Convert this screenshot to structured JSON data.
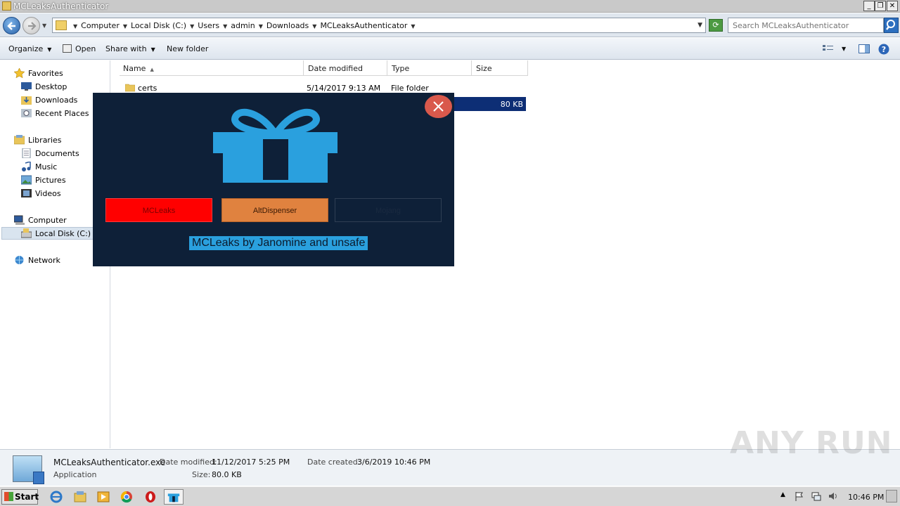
{
  "window": {
    "title": "MCLeaksAuthenticator",
    "controls": [
      "_",
      "❐",
      "✕"
    ]
  },
  "address_bar": {
    "breadcrumbs": [
      "Computer",
      "Local Disk (C:)",
      "Users",
      "admin",
      "Downloads",
      "MCLeaksAuthenticator"
    ],
    "search_placeholder": "Search MCLeaksAuthenticator"
  },
  "toolbar": {
    "organize": "Organize",
    "open": "Open",
    "share_with": "Share with",
    "new_folder": "New folder"
  },
  "nav": {
    "favorites": "Favorites",
    "desktop": "Desktop",
    "downloads": "Downloads",
    "recent_places": "Recent Places",
    "libraries": "Libraries",
    "documents": "Documents",
    "music": "Music",
    "pictures": "Pictures",
    "videos": "Videos",
    "computer": "Computer",
    "local_disk": "Local Disk (C:)",
    "network": "Network"
  },
  "columns": {
    "name": "Name",
    "date_modified": "Date modified",
    "type": "Type",
    "size": "Size"
  },
  "files": [
    {
      "name": "certs",
      "date_modified": "5/14/2017 9:13 AM",
      "type": "File folder",
      "size": ""
    },
    {
      "name": "",
      "date_modified": "",
      "type": "",
      "size": "80 KB"
    }
  ],
  "details": {
    "filename": "MCLeaksAuthenticator.exe",
    "date_modified_label": "Date modified:",
    "date_modified": "11/12/2017 5:25 PM",
    "date_created_label": "Date created:",
    "date_created": "3/6/2019 10:46 PM",
    "kind": "Application",
    "size_label": "Size:",
    "size": "80.0 KB"
  },
  "dialog": {
    "buttons": {
      "mcleaks": "MCLeaks",
      "altdispenser": "AltDispenser",
      "mojang": "Mojang"
    },
    "caption": "MCLeaks by Janomine and unsafe",
    "colors": {
      "background": "#0e2038",
      "gift": "#2aa0de",
      "close": "#d9594c",
      "mcleaks": "#ff0000",
      "altdispenser": "#e0823f"
    }
  },
  "taskbar": {
    "start": "Start",
    "clock": "10:46 PM"
  },
  "watermark": "ANY RUN"
}
